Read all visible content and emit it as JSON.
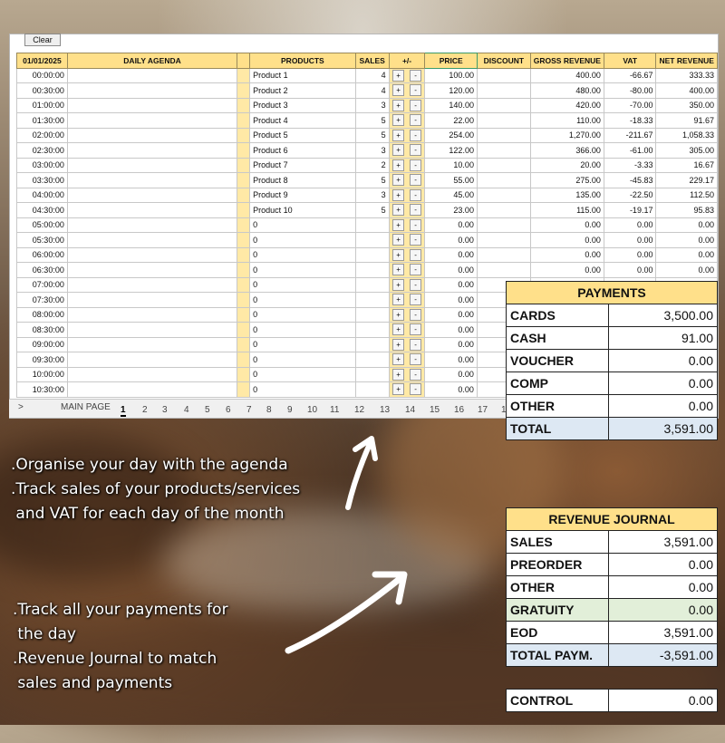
{
  "toolbar": {
    "clear_label": "Clear"
  },
  "table": {
    "headers": {
      "date": "01/01/2025",
      "agenda": "DAILY AGENDA",
      "products": "PRODUCTS",
      "sales": "SALES",
      "plusminus": "+/-",
      "price": "PRICE",
      "discount": "DISCOUNT",
      "gross": "GROSS REVENUE",
      "vat": "VAT",
      "net": "NET REVENUE"
    },
    "plus_label": "+",
    "minus_label": "-",
    "rows": [
      {
        "time": "00:00:00",
        "product": "Product 1",
        "sales": "4",
        "price": "100.00",
        "gross": "400.00",
        "vat": "-66.67",
        "net": "333.33"
      },
      {
        "time": "00:30:00",
        "product": "Product 2",
        "sales": "4",
        "price": "120.00",
        "gross": "480.00",
        "vat": "-80.00",
        "net": "400.00"
      },
      {
        "time": "01:00:00",
        "product": "Product 3",
        "sales": "3",
        "price": "140.00",
        "gross": "420.00",
        "vat": "-70.00",
        "net": "350.00"
      },
      {
        "time": "01:30:00",
        "product": "Product 4",
        "sales": "5",
        "price": "22.00",
        "gross": "110.00",
        "vat": "-18.33",
        "net": "91.67"
      },
      {
        "time": "02:00:00",
        "product": "Product 5",
        "sales": "5",
        "price": "254.00",
        "gross": "1,270.00",
        "vat": "-211.67",
        "net": "1,058.33"
      },
      {
        "time": "02:30:00",
        "product": "Product 6",
        "sales": "3",
        "price": "122.00",
        "gross": "366.00",
        "vat": "-61.00",
        "net": "305.00"
      },
      {
        "time": "03:00:00",
        "product": "Product 7",
        "sales": "2",
        "price": "10.00",
        "gross": "20.00",
        "vat": "-3.33",
        "net": "16.67"
      },
      {
        "time": "03:30:00",
        "product": "Product 8",
        "sales": "5",
        "price": "55.00",
        "gross": "275.00",
        "vat": "-45.83",
        "net": "229.17"
      },
      {
        "time": "04:00:00",
        "product": "Product 9",
        "sales": "3",
        "price": "45.00",
        "gross": "135.00",
        "vat": "-22.50",
        "net": "112.50"
      },
      {
        "time": "04:30:00",
        "product": "Product 10",
        "sales": "5",
        "price": "23.00",
        "gross": "115.00",
        "vat": "-19.17",
        "net": "95.83"
      },
      {
        "time": "05:00:00",
        "product": "0",
        "sales": "",
        "price": "0.00",
        "gross": "0.00",
        "vat": "0.00",
        "net": "0.00"
      },
      {
        "time": "05:30:00",
        "product": "0",
        "sales": "",
        "price": "0.00",
        "gross": "0.00",
        "vat": "0.00",
        "net": "0.00"
      },
      {
        "time": "06:00:00",
        "product": "0",
        "sales": "",
        "price": "0.00",
        "gross": "0.00",
        "vat": "0.00",
        "net": "0.00"
      },
      {
        "time": "06:30:00",
        "product": "0",
        "sales": "",
        "price": "0.00",
        "gross": "0.00",
        "vat": "0.00",
        "net": "0.00"
      },
      {
        "time": "07:00:00",
        "product": "0",
        "sales": "",
        "price": "0.00",
        "gross": "",
        "vat": "",
        "net": ""
      },
      {
        "time": "07:30:00",
        "product": "0",
        "sales": "",
        "price": "0.00",
        "gross": "",
        "vat": "",
        "net": ""
      },
      {
        "time": "08:00:00",
        "product": "0",
        "sales": "",
        "price": "0.00",
        "gross": "",
        "vat": "",
        "net": ""
      },
      {
        "time": "08:30:00",
        "product": "0",
        "sales": "",
        "price": "0.00",
        "gross": "",
        "vat": "",
        "net": ""
      },
      {
        "time": "09:00:00",
        "product": "0",
        "sales": "",
        "price": "0.00",
        "gross": "",
        "vat": "",
        "net": ""
      },
      {
        "time": "09:30:00",
        "product": "0",
        "sales": "",
        "price": "0.00",
        "gross": "",
        "vat": "",
        "net": ""
      },
      {
        "time": "10:00:00",
        "product": "0",
        "sales": "",
        "price": "0.00",
        "gross": "",
        "vat": "",
        "net": ""
      },
      {
        "time": "10:30:00",
        "product": "0",
        "sales": "",
        "price": "0.00",
        "gross": "",
        "vat": "",
        "net": ""
      }
    ]
  },
  "tabs": {
    "nav_glyph": ">",
    "main_label": "MAIN PAGE",
    "items": [
      "1",
      "2",
      "3",
      "4",
      "5",
      "6",
      "7",
      "8",
      "9",
      "10",
      "11",
      "12",
      "13",
      "14",
      "15",
      "16",
      "17",
      "1"
    ],
    "active": "1"
  },
  "payments": {
    "title": "PAYMENTS",
    "rows": [
      {
        "label": "CARDS",
        "value": "3,500.00"
      },
      {
        "label": "CASH",
        "value": "91.00"
      },
      {
        "label": "VOUCHER",
        "value": "0.00"
      },
      {
        "label": "COMP",
        "value": "0.00"
      },
      {
        "label": "OTHER",
        "value": "0.00"
      }
    ],
    "total_label": "TOTAL",
    "total_value": "3,591.00"
  },
  "journal": {
    "title": "REVENUE JOURNAL",
    "rows": [
      {
        "label": "SALES",
        "value": "3,591.00"
      },
      {
        "label": "PREORDER",
        "value": "0.00"
      },
      {
        "label": "OTHER",
        "value": "0.00"
      }
    ],
    "gratuity_label": "GRATUITY",
    "gratuity_value": "0.00",
    "eod_label": "EOD",
    "eod_value": "3,591.00",
    "total_label": "TOTAL PAYM.",
    "total_value": "-3,591.00"
  },
  "control": {
    "label": "CONTROL",
    "value": "0.00"
  },
  "captions": {
    "top": ".Organise your day with the agenda\n.Track sales of your products/services\n and VAT for each day of the month",
    "bottom": ".Track all your payments for\n the day\n.Revenue Journal to match\n sales and payments"
  },
  "colors": {
    "header": "#ffe08a",
    "total": "#dde8f3",
    "gratuity": "#e2efd9"
  }
}
